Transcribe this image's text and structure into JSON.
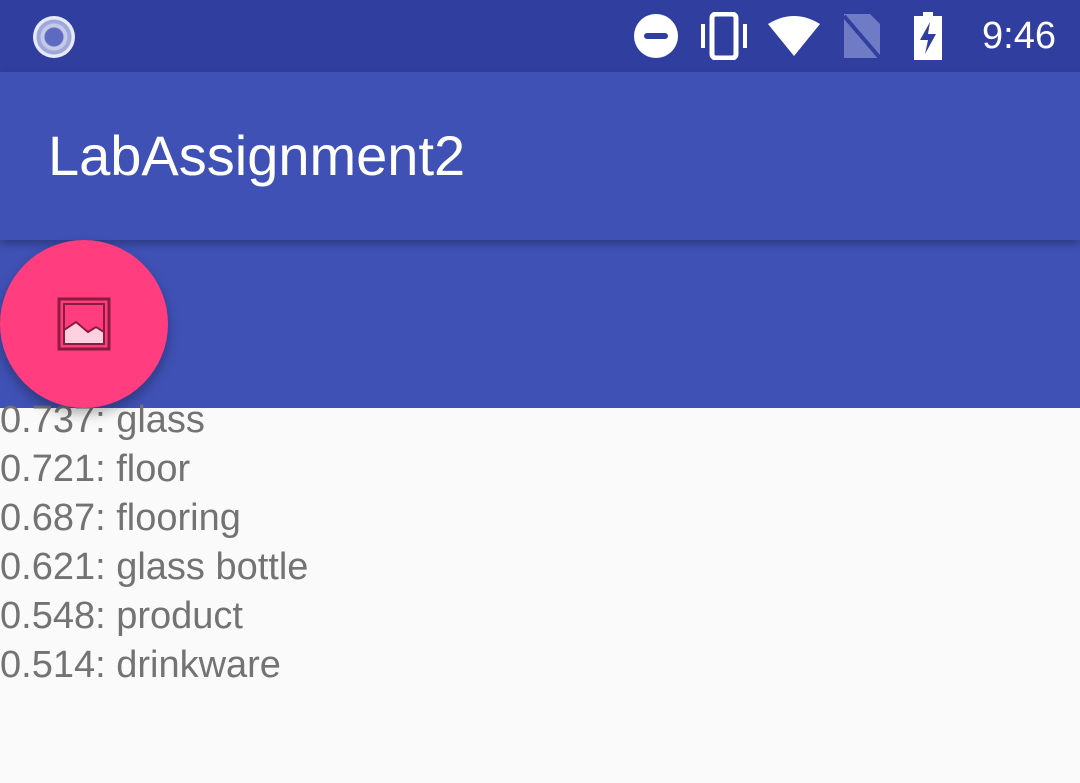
{
  "status_bar": {
    "time": "9:46",
    "icons": [
      "sync-icon",
      "do-not-disturb-icon",
      "vibrate-icon",
      "wifi-icon",
      "no-sim-icon",
      "battery-charging-icon"
    ]
  },
  "app_bar": {
    "title": "LabAssignment2"
  },
  "fab": {
    "icon": "image-icon",
    "color": "#FF3D7F"
  },
  "colors": {
    "primary": "#3F51B5",
    "primary_dark": "#303F9F",
    "accent": "#FF3D7F",
    "background": "#FAFAFA"
  },
  "results": [
    "0.737: glass",
    "0.721: floor",
    "0.687: flooring",
    "0.621: glass bottle",
    "0.548: product",
    "0.514: drinkware"
  ]
}
